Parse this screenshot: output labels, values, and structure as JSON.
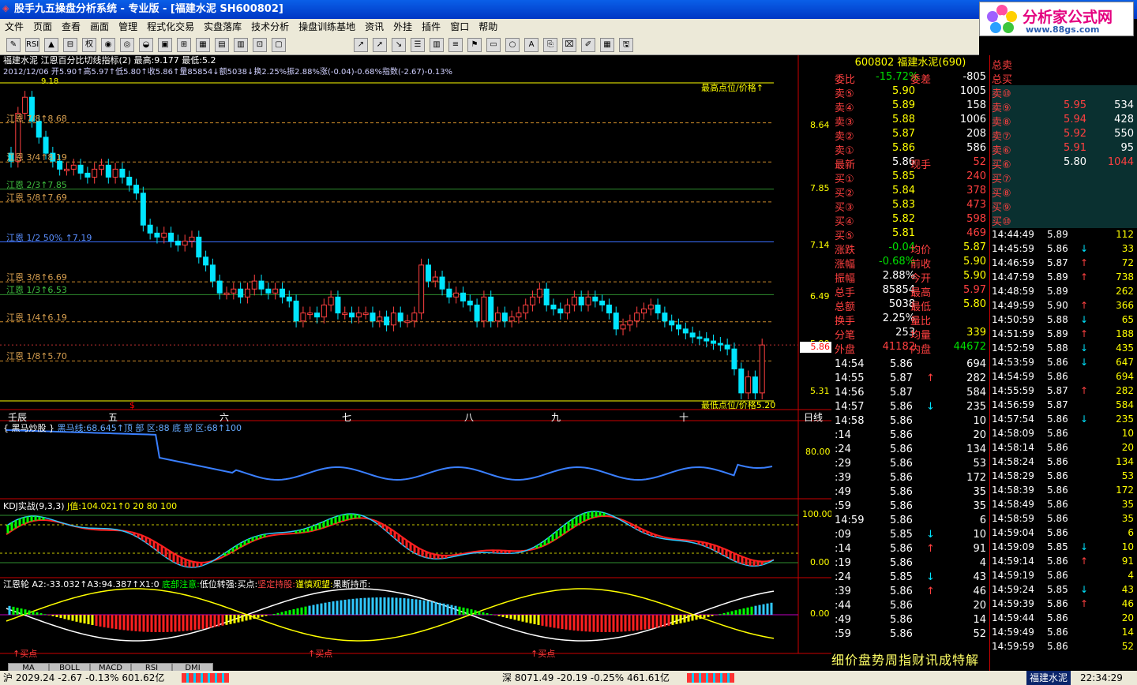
{
  "window": {
    "title": "股手九五操盘分析系统 - 专业版 - [福建水泥 SH600802]"
  },
  "brand": {
    "name": "分析家公式网",
    "url": "www.88gs.com"
  },
  "menu": [
    "文件",
    "页面",
    "查看",
    "画面",
    "管理",
    "程式化交易",
    "实盘落库",
    "技术分析",
    "操盘训练基地",
    "资讯",
    "外挂",
    "插件",
    "窗口",
    "帮助"
  ],
  "chart": {
    "header": "福建水泥 江恩百分比切线指标(2) 最高:9.177 最低:5.2",
    "ohlc": "2012/12/06 开5.90↑高5.97↑低5.80↑收5.86↑量85854↓额5038↓换2.25%振2.88%涨(-0.04)-0.68%指数(-2.67)-0.13%",
    "maxlabel": "9.18",
    "toplabel": "最高点位/价格↑",
    "botlabel": "最低点位/价格5.20",
    "levels": [
      "江恩 7/8↑8.68",
      "江恩 3/4↑8.19",
      "江恩 2/3↑7.85",
      "江恩 5/8↑7.69",
      "江恩 1/2  50%  ↑7.19",
      "江恩 3/8↑6.69",
      "江恩 1/3↑6.53",
      "江恩 1/4↑6.19",
      "江恩 1/8↑5.70"
    ],
    "axis": [
      "8.64",
      "7.85",
      "7.14",
      "6.49",
      "5.90",
      "5.31"
    ],
    "curprice": "5.86",
    "months": [
      "壬辰",
      "五",
      "六",
      "七",
      "八",
      "九",
      "十"
    ],
    "period": "日线",
    "marker": "$"
  },
  "sub1": {
    "title": "{ 黑马炒股 }",
    "val": "黑马线:68.645↑顶  部  区:88 底  部  区:68↑100",
    "axis": "80.00"
  },
  "sub2": {
    "title": "KDJ实战(9,3,3)",
    "val": "J值:104.021↑0  20  80  100",
    "axis1": "100.00",
    "axis2": "0.00"
  },
  "sub3": {
    "title": "江恩轮",
    "a": "A2:-33.032↑A3:94.387↑X1:0",
    "b": "底部注意:",
    "c": "低位转强:买点:",
    "d": "坚定持股:",
    "e": "谨慎观望:",
    "f": "果断持币:",
    "axis": "0.00",
    "buy": "↑买点"
  },
  "tabs": [
    "MA",
    "BOLL",
    "MACD",
    "RSI",
    "DMI"
  ],
  "quote": {
    "code": "600802 福建水泥(690)",
    "weibi": "委比",
    "weibi_v": "-15.72%",
    "weicha": "委差",
    "weicha_v": "-805",
    "sells": [
      [
        "卖⑤",
        "5.90",
        "1005"
      ],
      [
        "卖④",
        "5.89",
        "158"
      ],
      [
        "卖③",
        "5.88",
        "1006"
      ],
      [
        "卖②",
        "5.87",
        "208"
      ],
      [
        "卖①",
        "5.86",
        "586"
      ]
    ],
    "latest": [
      "最新",
      "5.86",
      "现手",
      "52"
    ],
    "buys": [
      [
        "买①",
        "5.85",
        "240"
      ],
      [
        "买②",
        "5.84",
        "378"
      ],
      [
        "买③",
        "5.83",
        "473"
      ],
      [
        "买④",
        "5.82",
        "598"
      ],
      [
        "买⑤",
        "5.81",
        "469"
      ]
    ],
    "stats": [
      [
        "涨跌",
        "-0.04",
        "均价",
        "5.87"
      ],
      [
        "涨幅",
        "-0.68%",
        "前收",
        "5.90"
      ],
      [
        "振幅",
        "2.88%",
        "今开",
        "5.90"
      ],
      [
        "总手",
        "85854",
        "最高",
        "5.97"
      ],
      [
        "总额",
        "5038",
        "最低",
        "5.80"
      ],
      [
        "换手",
        "2.25%",
        "量比",
        ""
      ],
      [
        "分笔",
        "253",
        "均量",
        "339"
      ]
    ],
    "waipan": "外盘",
    "waipan_v": "41182",
    "neipan": "内盘",
    "neipan_v": "44672",
    "ticks": [
      [
        "14:54",
        "5.86",
        "694",
        ""
      ],
      [
        "14:55",
        "5.87",
        "282",
        "↑"
      ],
      [
        "14:56",
        "5.87",
        "584",
        ""
      ],
      [
        "14:57",
        "5.86",
        "235",
        "↓"
      ],
      [
        "14:58",
        "5.86",
        "10",
        ""
      ],
      [
        ":14",
        "5.86",
        "20",
        ""
      ],
      [
        ":24",
        "5.86",
        "134",
        ""
      ],
      [
        ":29",
        "5.86",
        "53",
        ""
      ],
      [
        ":39",
        "5.86",
        "172",
        ""
      ],
      [
        ":49",
        "5.86",
        "35",
        ""
      ],
      [
        ":59",
        "5.86",
        "35",
        ""
      ],
      [
        "14:59",
        "5.86",
        "6",
        ""
      ],
      [
        ":09",
        "5.85",
        "10",
        "↓"
      ],
      [
        ":14",
        "5.86",
        "91",
        "↑"
      ],
      [
        ":19",
        "5.86",
        "4",
        ""
      ],
      [
        ":24",
        "5.85",
        "43",
        "↓"
      ],
      [
        ":39",
        "5.86",
        "46",
        "↑"
      ],
      [
        ":44",
        "5.86",
        "20",
        ""
      ],
      [
        ":49",
        "5.86",
        "14",
        ""
      ],
      [
        ":59",
        "5.86",
        "52",
        ""
      ]
    ],
    "bottomtabs": "细价盘势周指财讯成特解"
  },
  "deep": {
    "h1": "总卖",
    "h2": "总买",
    "sells": [
      [
        "卖⑩",
        "",
        ""
      ],
      [
        "卖⑨",
        "5.95",
        "534"
      ],
      [
        "卖⑧",
        "5.94",
        "428"
      ],
      [
        "卖⑦",
        "5.92",
        "550"
      ],
      [
        "卖⑥",
        "5.91",
        "95"
      ]
    ],
    "buys": [
      [
        "买⑥",
        "5.80",
        "1044"
      ],
      [
        "买⑦",
        "",
        ""
      ],
      [
        "买⑧",
        "",
        ""
      ],
      [
        "买⑨",
        "",
        ""
      ],
      [
        "买⑩",
        "",
        ""
      ]
    ],
    "ticks": [
      [
        "14:44:49",
        "5.89",
        "112",
        ""
      ],
      [
        "14:45:59",
        "5.86",
        "33",
        "↓"
      ],
      [
        "14:46:59",
        "5.87",
        "72",
        "↑"
      ],
      [
        "14:47:59",
        "5.89",
        "738",
        "↑"
      ],
      [
        "14:48:59",
        "5.89",
        "262",
        ""
      ],
      [
        "14:49:59",
        "5.90",
        "366",
        "↑"
      ],
      [
        "14:50:59",
        "5.88",
        "65",
        "↓"
      ],
      [
        "14:51:59",
        "5.89",
        "188",
        "↑"
      ],
      [
        "14:52:59",
        "5.88",
        "435",
        "↓"
      ],
      [
        "14:53:59",
        "5.86",
        "647",
        "↓"
      ],
      [
        "14:54:59",
        "5.86",
        "694",
        ""
      ],
      [
        "14:55:59",
        "5.87",
        "282",
        "↑"
      ],
      [
        "14:56:59",
        "5.87",
        "584",
        ""
      ],
      [
        "14:57:54",
        "5.86",
        "235",
        "↓"
      ],
      [
        "14:58:09",
        "5.86",
        "10",
        ""
      ],
      [
        "14:58:14",
        "5.86",
        "20",
        ""
      ],
      [
        "14:58:24",
        "5.86",
        "134",
        ""
      ],
      [
        "14:58:29",
        "5.86",
        "53",
        ""
      ],
      [
        "14:58:39",
        "5.86",
        "172",
        ""
      ],
      [
        "14:58:49",
        "5.86",
        "35",
        ""
      ],
      [
        "14:58:59",
        "5.86",
        "35",
        ""
      ],
      [
        "14:59:04",
        "5.86",
        "6",
        ""
      ],
      [
        "14:59:09",
        "5.85",
        "10",
        "↓"
      ],
      [
        "14:59:14",
        "5.86",
        "91",
        "↑"
      ],
      [
        "14:59:19",
        "5.86",
        "4",
        ""
      ],
      [
        "14:59:24",
        "5.85",
        "43",
        "↓"
      ],
      [
        "14:59:39",
        "5.86",
        "46",
        "↑"
      ],
      [
        "14:59:44",
        "5.86",
        "20",
        ""
      ],
      [
        "14:59:49",
        "5.86",
        "14",
        ""
      ],
      [
        "14:59:59",
        "5.86",
        "52",
        ""
      ]
    ]
  },
  "status": {
    "sh": "沪 2029.24 -2.67 -0.13% 601.62亿",
    "sz": "深 8071.49 -20.19 -0.25% 461.61亿",
    "stock": "福建水泥",
    "time": "22:34:29"
  }
}
